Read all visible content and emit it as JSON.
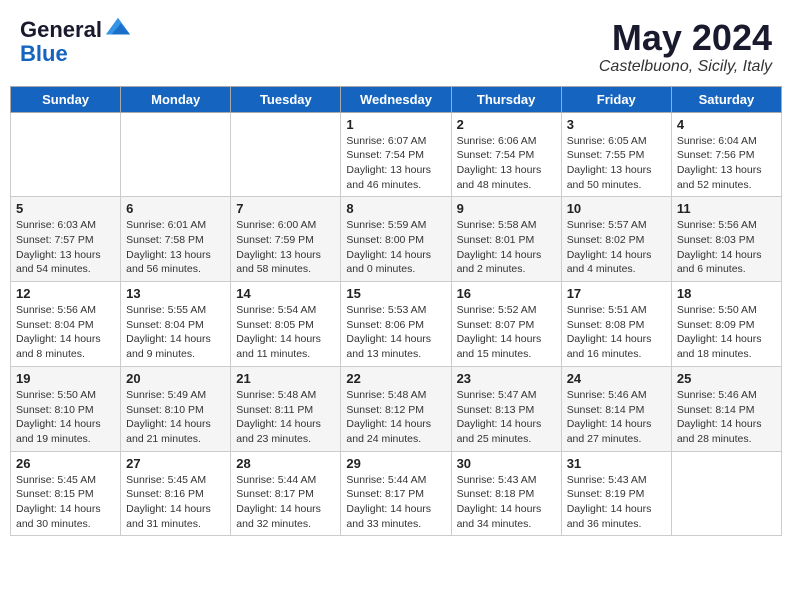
{
  "header": {
    "logo_line1": "General",
    "logo_line2": "Blue",
    "month": "May 2024",
    "location": "Castelbuono, Sicily, Italy"
  },
  "weekdays": [
    "Sunday",
    "Monday",
    "Tuesday",
    "Wednesday",
    "Thursday",
    "Friday",
    "Saturday"
  ],
  "weeks": [
    [
      {
        "day": "",
        "sunrise": "",
        "sunset": "",
        "daylight": ""
      },
      {
        "day": "",
        "sunrise": "",
        "sunset": "",
        "daylight": ""
      },
      {
        "day": "",
        "sunrise": "",
        "sunset": "",
        "daylight": ""
      },
      {
        "day": "1",
        "sunrise": "6:07 AM",
        "sunset": "7:54 PM",
        "daylight": "13 hours and 46 minutes."
      },
      {
        "day": "2",
        "sunrise": "6:06 AM",
        "sunset": "7:54 PM",
        "daylight": "13 hours and 48 minutes."
      },
      {
        "day": "3",
        "sunrise": "6:05 AM",
        "sunset": "7:55 PM",
        "daylight": "13 hours and 50 minutes."
      },
      {
        "day": "4",
        "sunrise": "6:04 AM",
        "sunset": "7:56 PM",
        "daylight": "13 hours and 52 minutes."
      }
    ],
    [
      {
        "day": "5",
        "sunrise": "6:03 AM",
        "sunset": "7:57 PM",
        "daylight": "13 hours and 54 minutes."
      },
      {
        "day": "6",
        "sunrise": "6:01 AM",
        "sunset": "7:58 PM",
        "daylight": "13 hours and 56 minutes."
      },
      {
        "day": "7",
        "sunrise": "6:00 AM",
        "sunset": "7:59 PM",
        "daylight": "13 hours and 58 minutes."
      },
      {
        "day": "8",
        "sunrise": "5:59 AM",
        "sunset": "8:00 PM",
        "daylight": "14 hours and 0 minutes."
      },
      {
        "day": "9",
        "sunrise": "5:58 AM",
        "sunset": "8:01 PM",
        "daylight": "14 hours and 2 minutes."
      },
      {
        "day": "10",
        "sunrise": "5:57 AM",
        "sunset": "8:02 PM",
        "daylight": "14 hours and 4 minutes."
      },
      {
        "day": "11",
        "sunrise": "5:56 AM",
        "sunset": "8:03 PM",
        "daylight": "14 hours and 6 minutes."
      }
    ],
    [
      {
        "day": "12",
        "sunrise": "5:56 AM",
        "sunset": "8:04 PM",
        "daylight": "14 hours and 8 minutes."
      },
      {
        "day": "13",
        "sunrise": "5:55 AM",
        "sunset": "8:04 PM",
        "daylight": "14 hours and 9 minutes."
      },
      {
        "day": "14",
        "sunrise": "5:54 AM",
        "sunset": "8:05 PM",
        "daylight": "14 hours and 11 minutes."
      },
      {
        "day": "15",
        "sunrise": "5:53 AM",
        "sunset": "8:06 PM",
        "daylight": "14 hours and 13 minutes."
      },
      {
        "day": "16",
        "sunrise": "5:52 AM",
        "sunset": "8:07 PM",
        "daylight": "14 hours and 15 minutes."
      },
      {
        "day": "17",
        "sunrise": "5:51 AM",
        "sunset": "8:08 PM",
        "daylight": "14 hours and 16 minutes."
      },
      {
        "day": "18",
        "sunrise": "5:50 AM",
        "sunset": "8:09 PM",
        "daylight": "14 hours and 18 minutes."
      }
    ],
    [
      {
        "day": "19",
        "sunrise": "5:50 AM",
        "sunset": "8:10 PM",
        "daylight": "14 hours and 19 minutes."
      },
      {
        "day": "20",
        "sunrise": "5:49 AM",
        "sunset": "8:10 PM",
        "daylight": "14 hours and 21 minutes."
      },
      {
        "day": "21",
        "sunrise": "5:48 AM",
        "sunset": "8:11 PM",
        "daylight": "14 hours and 23 minutes."
      },
      {
        "day": "22",
        "sunrise": "5:48 AM",
        "sunset": "8:12 PM",
        "daylight": "14 hours and 24 minutes."
      },
      {
        "day": "23",
        "sunrise": "5:47 AM",
        "sunset": "8:13 PM",
        "daylight": "14 hours and 25 minutes."
      },
      {
        "day": "24",
        "sunrise": "5:46 AM",
        "sunset": "8:14 PM",
        "daylight": "14 hours and 27 minutes."
      },
      {
        "day": "25",
        "sunrise": "5:46 AM",
        "sunset": "8:14 PM",
        "daylight": "14 hours and 28 minutes."
      }
    ],
    [
      {
        "day": "26",
        "sunrise": "5:45 AM",
        "sunset": "8:15 PM",
        "daylight": "14 hours and 30 minutes."
      },
      {
        "day": "27",
        "sunrise": "5:45 AM",
        "sunset": "8:16 PM",
        "daylight": "14 hours and 31 minutes."
      },
      {
        "day": "28",
        "sunrise": "5:44 AM",
        "sunset": "8:17 PM",
        "daylight": "14 hours and 32 minutes."
      },
      {
        "day": "29",
        "sunrise": "5:44 AM",
        "sunset": "8:17 PM",
        "daylight": "14 hours and 33 minutes."
      },
      {
        "day": "30",
        "sunrise": "5:43 AM",
        "sunset": "8:18 PM",
        "daylight": "14 hours and 34 minutes."
      },
      {
        "day": "31",
        "sunrise": "5:43 AM",
        "sunset": "8:19 PM",
        "daylight": "14 hours and 36 minutes."
      },
      {
        "day": "",
        "sunrise": "",
        "sunset": "",
        "daylight": ""
      }
    ]
  ]
}
